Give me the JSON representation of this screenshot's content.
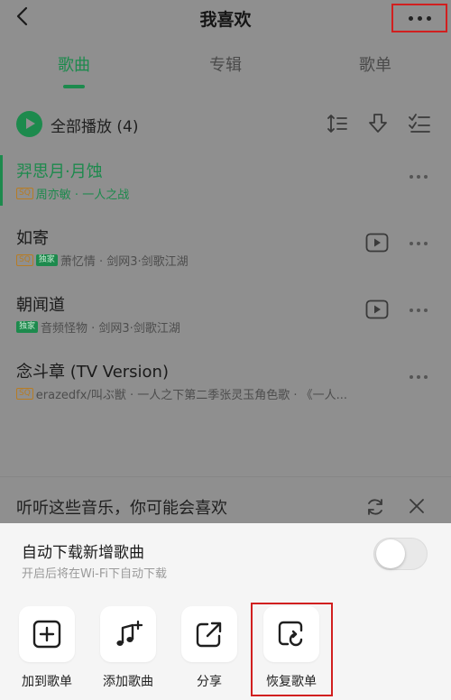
{
  "header": {
    "title": "我喜欢",
    "back_icon": "chevron-left-icon",
    "more_icon": "more-dots-icon"
  },
  "tabs": [
    {
      "label": "歌曲",
      "active": true
    },
    {
      "label": "专辑",
      "active": false
    },
    {
      "label": "歌单",
      "active": false
    }
  ],
  "play_all": {
    "label": "全部播放 (4)",
    "icons": [
      "sort-icon",
      "download-icon",
      "multi-select-icon"
    ]
  },
  "songs": [
    {
      "title": "羿思月·月蚀",
      "badges": [
        "SQ"
      ],
      "meta": "周亦敏 · 一人之战",
      "has_mv": false,
      "playing": true
    },
    {
      "title": "如寄",
      "badges": [
        "SQ",
        "独家"
      ],
      "meta": "萧忆情 · 剑网3·剑歌江湖",
      "has_mv": true,
      "playing": false
    },
    {
      "title": "朝闻道",
      "badges": [
        "独家"
      ],
      "meta": "音频怪物 · 剑网3·剑歌江湖",
      "has_mv": true,
      "playing": false
    },
    {
      "title": "念斗章 (TV Version)",
      "badges": [
        "SQ"
      ],
      "meta": "erazedfx/叫ぶ獣 · 一人之下第二季张灵玉角色歌 · 《一人...",
      "has_mv": false,
      "playing": false
    }
  ],
  "recommend": {
    "text": "听听这些音乐，你可能会喜欢"
  },
  "sheet": {
    "auto_download": {
      "title": "自动下载新增歌曲",
      "subtitle": "开启后将在Wi-Fi下自动下载",
      "enabled": false
    },
    "actions": [
      {
        "label": "加到歌单",
        "icon": "add-square-icon"
      },
      {
        "label": "添加歌曲",
        "icon": "music-add-icon"
      },
      {
        "label": "分享",
        "icon": "share-icon"
      },
      {
        "label": "恢复歌单",
        "icon": "restore-icon"
      }
    ]
  },
  "colors": {
    "accent": "#1d8a4d",
    "highlight_box": "#d11f1f",
    "sq_badge": "#b77c24"
  }
}
